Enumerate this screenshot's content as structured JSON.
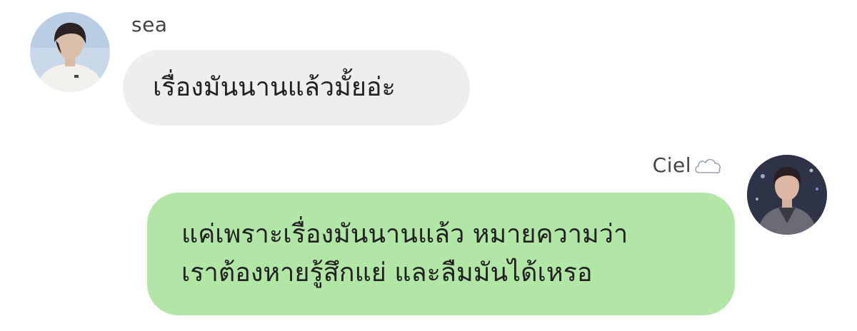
{
  "messages": [
    {
      "sender": "sea",
      "lines": [
        "เรื่องมันนานแล้วมั้ยอ่ะ"
      ],
      "bubble_color": "#eeeeee"
    },
    {
      "sender": "Ciel",
      "sender_icon": "cloud-icon",
      "lines": [
        "แค่เพราะเรื่องมันนานแล้ว หมายความว่า",
        "เราต้องหายรู้สึกแย่ และลืมมันได้เหรอ"
      ],
      "bubble_color": "#b2e6a7"
    }
  ]
}
